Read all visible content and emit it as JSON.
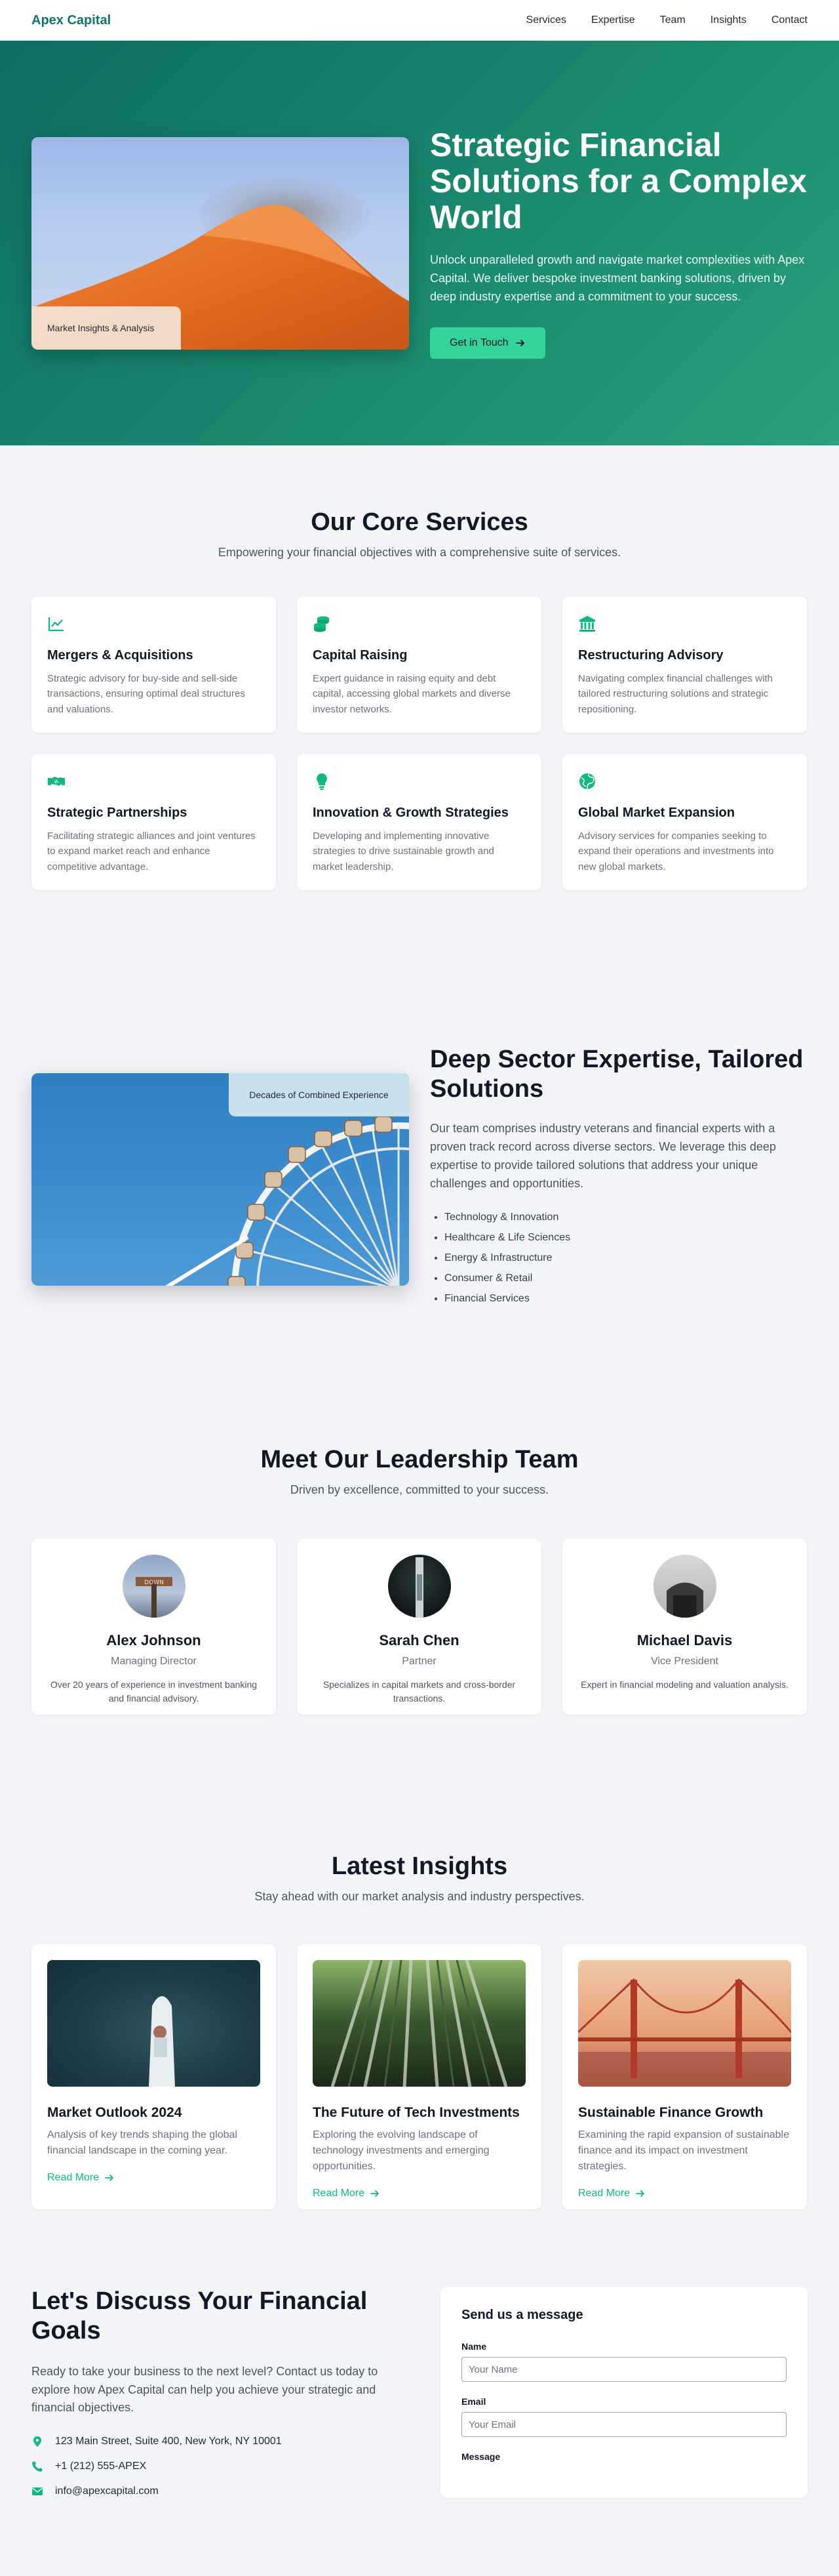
{
  "nav": {
    "brand": "Apex Capital",
    "links": [
      "Services",
      "Expertise",
      "Team",
      "Insights",
      "Contact"
    ]
  },
  "hero": {
    "image_label": "Market Insights & Analysis",
    "title": "Strategic Financial Solutions for a Complex World",
    "description": "Unlock unparalleled growth and navigate market complexities with Apex Capital. We deliver bespoke investment banking solutions, driven by deep industry expertise and a commitment to your success.",
    "cta": "Get in Touch"
  },
  "services": {
    "title": "Our Core Services",
    "subtitle": "Empowering your financial objectives with a comprehensive suite of services.",
    "items": [
      {
        "icon": "chart-line-icon",
        "title": "Mergers & Acquisitions",
        "text": "Strategic advisory for buy-side and sell-side transactions, ensuring optimal deal structures and valuations."
      },
      {
        "icon": "coins-icon",
        "title": "Capital Raising",
        "text": "Expert guidance in raising equity and debt capital, accessing global markets and diverse investor networks."
      },
      {
        "icon": "bank-icon",
        "title": "Restructuring Advisory",
        "text": "Navigating complex financial challenges with tailored restructuring solutions and strategic repositioning."
      },
      {
        "icon": "handshake-icon",
        "title": "Strategic Partnerships",
        "text": "Facilitating strategic alliances and joint ventures to expand market reach and enhance competitive advantage."
      },
      {
        "icon": "lightbulb-icon",
        "title": "Innovation & Growth Strategies",
        "text": "Developing and implementing innovative strategies to drive sustainable growth and market leadership."
      },
      {
        "icon": "globe-icon",
        "title": "Global Market Expansion",
        "text": "Advisory services for companies seeking to expand their operations and investments into new global markets."
      }
    ]
  },
  "expertise": {
    "image_label": "Decades of Combined Experience",
    "title": "Deep Sector Expertise, Tailored Solutions",
    "description": "Our team comprises industry veterans and financial experts with a proven track record across diverse sectors. We leverage this deep expertise to provide tailored solutions that address your unique challenges and opportunities.",
    "sectors": [
      "Technology & Innovation",
      "Healthcare & Life Sciences",
      "Energy & Infrastructure",
      "Consumer & Retail",
      "Financial Services"
    ]
  },
  "team": {
    "title": "Meet Our Leadership Team",
    "subtitle": "Driven by excellence, committed to your success.",
    "members": [
      {
        "name": "Alex Johnson",
        "role": "Managing Director",
        "bio": "Over 20 years of experience in investment banking and financial advisory."
      },
      {
        "name": "Sarah Chen",
        "role": "Partner",
        "bio": "Specializes in capital markets and cross-border transactions."
      },
      {
        "name": "Michael Davis",
        "role": "Vice President",
        "bio": "Expert in financial modeling and valuation analysis."
      }
    ]
  },
  "insights": {
    "title": "Latest Insights",
    "subtitle": "Stay ahead with our market analysis and industry perspectives.",
    "read_more": "Read More",
    "articles": [
      {
        "title": "Market Outlook 2024",
        "text": "Analysis of key trends shaping the global financial landscape in the coming year."
      },
      {
        "title": "The Future of Tech Investments",
        "text": "Exploring the evolving landscape of technology investments and emerging opportunities."
      },
      {
        "title": "Sustainable Finance Growth",
        "text": "Examining the rapid expansion of sustainable finance and its impact on investment strategies."
      }
    ]
  },
  "contact": {
    "title": "Let's Discuss Your Financial Goals",
    "description": "Ready to take your business to the next level? Contact us today to explore how Apex Capital can help you achieve your strategic and financial objectives.",
    "address": "123 Main Street, Suite 400, New York, NY 10001",
    "phone": "+1 (212) 555-APEX",
    "email": "info@apexcapital.com",
    "form": {
      "title": "Send us a message",
      "name_label": "Name",
      "name_placeholder": "Your Name",
      "email_label": "Email",
      "email_placeholder": "Your Email",
      "message_label": "Message"
    }
  },
  "colors": {
    "brand": "#0f766e",
    "accent": "#34d399",
    "icon": "#10b981"
  }
}
